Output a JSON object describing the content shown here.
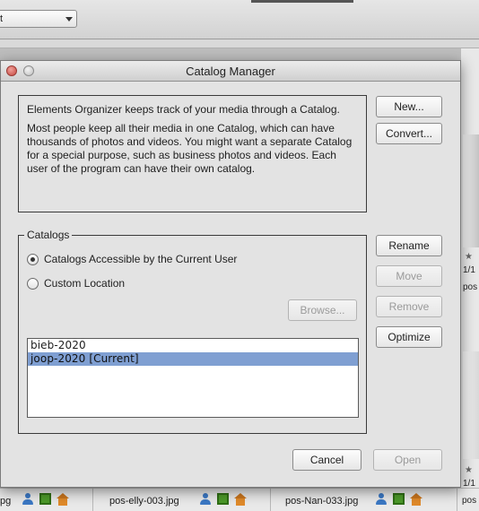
{
  "background": {
    "toolbar_select_value": "t",
    "right_column": {
      "date_top": "1/1",
      "text_top": "pos",
      "date_bottom": "1/1",
      "text_bottom": "pos"
    },
    "footer": {
      "files": [
        "pos-elly-003.jpg",
        "pos-Nan-033.jpg"
      ],
      "left_fragment": "pg"
    }
  },
  "dialog": {
    "title": "Catalog Manager",
    "info": {
      "paragraph1": "Elements Organizer keeps track of your media through a Catalog.",
      "paragraph2": "Most people keep all their media in one Catalog, which can have thousands of photos and videos. You might want a separate Catalog for a special purpose, such as business photos and videos. Each user of the program can have their own catalog."
    },
    "buttons": {
      "new": "New...",
      "convert": "Convert...",
      "rename": "Rename",
      "move": "Move",
      "remove": "Remove",
      "optimize": "Optimize",
      "browse": "Browse...",
      "cancel": "Cancel",
      "open": "Open"
    },
    "catalogs": {
      "legend": "Catalogs",
      "options": [
        {
          "label": "Catalogs Accessible by the Current User",
          "selected": true
        },
        {
          "label": "Custom Location",
          "selected": false
        }
      ],
      "list": [
        {
          "name": "bieb-2020",
          "selected": false
        },
        {
          "name": "joop-2020 [Current]",
          "selected": true
        }
      ]
    }
  }
}
